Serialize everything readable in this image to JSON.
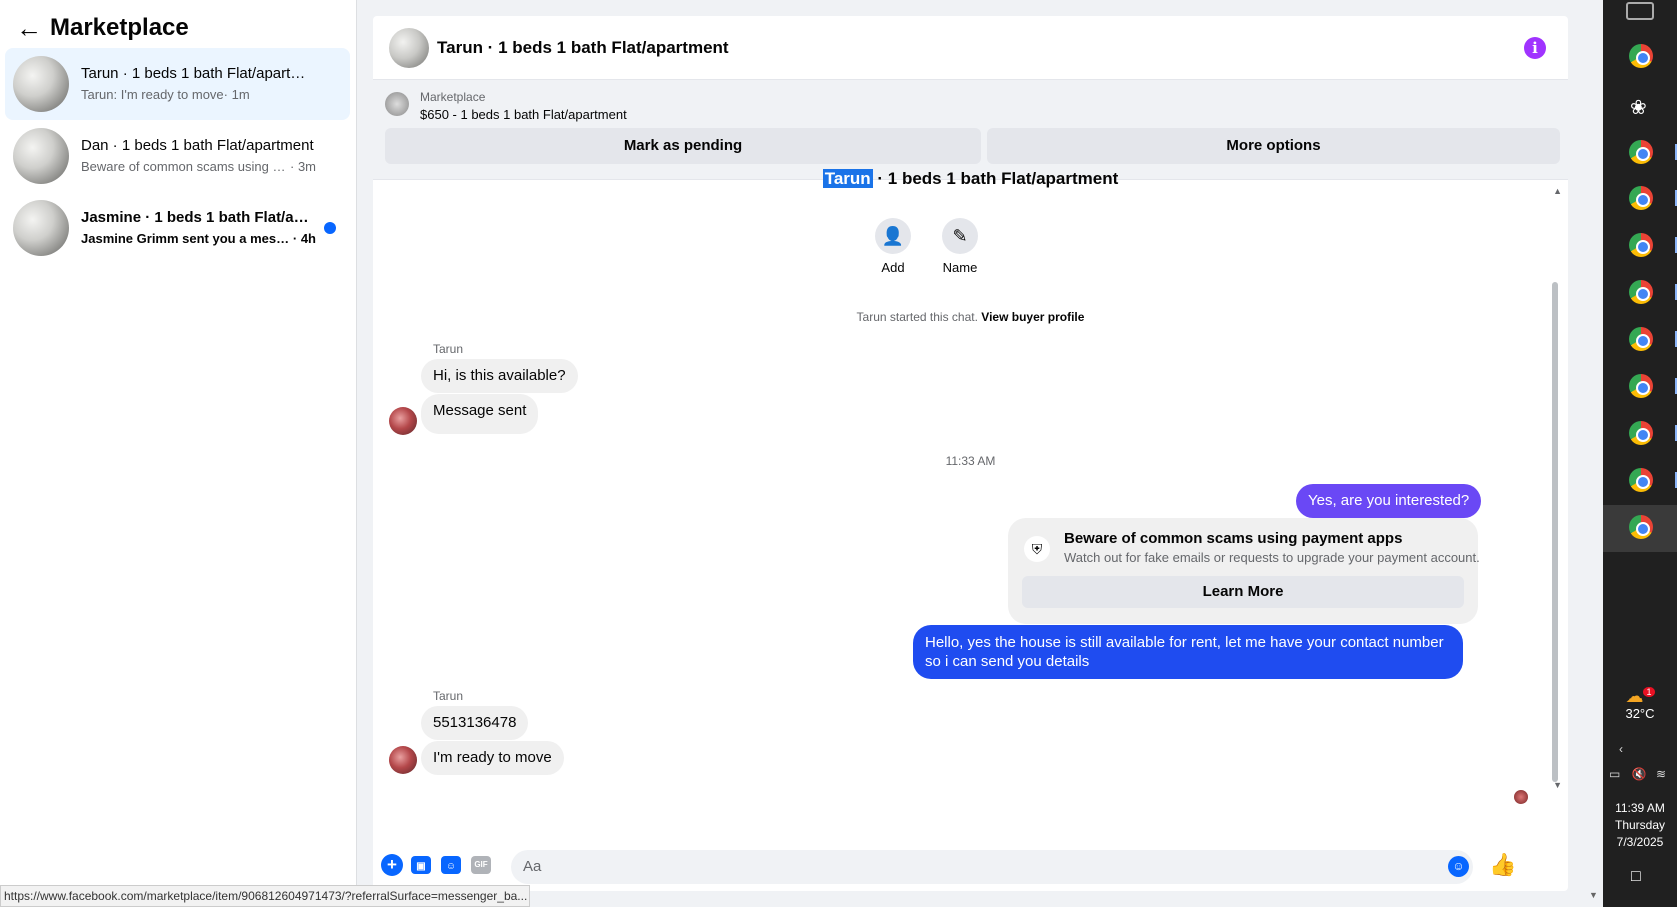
{
  "sidebar": {
    "back_icon": "arrow-left-icon",
    "title": "Marketplace",
    "conversations": [
      {
        "name": "Tarun · 1 beds 1 bath Flat/apartment",
        "preview": "Tarun: I'm ready to move",
        "time": " · 1m",
        "active": true,
        "unread": false
      },
      {
        "name": "Dan · 1 beds 1 bath Flat/apartment",
        "preview": "Beware of common scams using pay...",
        "time": " · 3m",
        "active": false,
        "unread": false
      },
      {
        "name": "Jasmine · 1 beds 1 bath Flat/apar...",
        "preview": "Jasmine Grimm sent you a messag...",
        "time": " · 4h",
        "active": false,
        "unread": true
      }
    ]
  },
  "chat": {
    "header_title": "Tarun · 1 beds 1 bath Flat/apartment",
    "info_icon": "i",
    "listing": {
      "source": "Marketplace",
      "title": "$650 - 1 beds 1 bath Flat/apartment",
      "mark_pending": "Mark as pending",
      "more_options": "More options"
    },
    "intro": {
      "name_highlight": "Tarun",
      "title_rest": " · 1 beds 1 bath Flat/apartment",
      "add_label": "Add",
      "name_label": "Name",
      "started_text": "Tarun started this chat. ",
      "view_profile": "View buyer profile"
    },
    "messages": {
      "sender1": "Tarun",
      "msg1": "Hi, is this available?",
      "msg2": "Message sent",
      "timestamp": "11:33 AM",
      "out1": "Yes, are you interested?",
      "scam_title": "Beware of common scams using payment apps",
      "scam_sub": "Watch out for fake emails or requests to upgrade your payment account.",
      "learn_more": "Learn More",
      "out2": "Hello, yes the house is still available for rent, let me have your contact number so i can send you details",
      "sender2": "Tarun",
      "msg3": "5513136478",
      "msg4": "I'm ready to move"
    },
    "composer": {
      "placeholder": "Aa",
      "gif_label": "GIF"
    }
  },
  "status_url": "https://www.facebook.com/marketplace/item/906812604971473/?referralSurface=messenger_ba...",
  "taskbar": {
    "weather_temp": "32°C",
    "weather_badge": "1",
    "time": "11:39 AM",
    "day": "Thursday",
    "date": "7/3/2025"
  },
  "colors": {
    "accent": "#0866ff",
    "outgoing_purple": "#6a48f5",
    "outgoing_blue": "#1f4cf0",
    "info_purple": "#a033ff"
  }
}
